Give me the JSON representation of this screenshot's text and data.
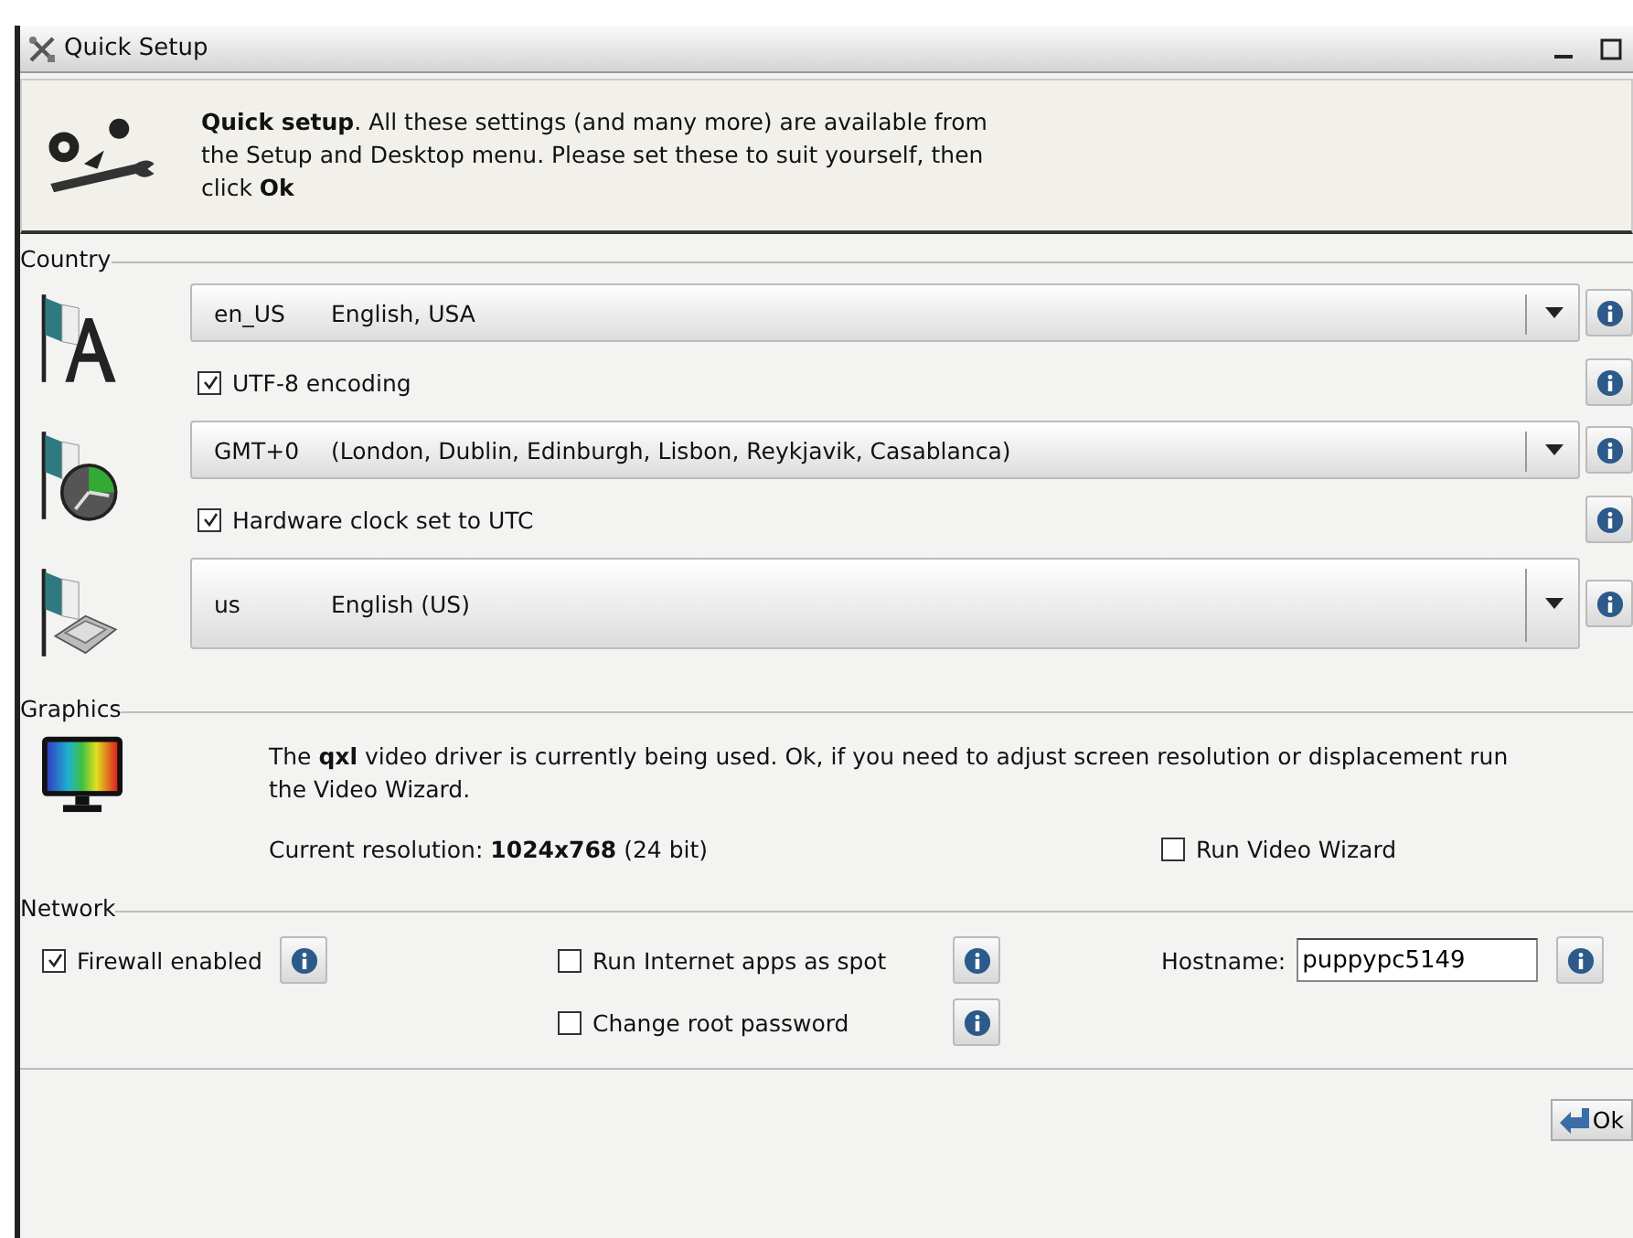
{
  "window": {
    "title": "Quick Setup"
  },
  "header": {
    "text": "**Quick setup**. All these settings (and many more) are available from the Setup and Desktop menu. Please set these to suit yourself, then click **Ok**"
  },
  "country": {
    "legend": "Country",
    "groups": [
      {
        "items": [
          {
            "kind": "combo",
            "code": "en_US",
            "label": "English, USA"
          },
          {
            "kind": "checkbox",
            "label": "UTF-8 encoding",
            "checked": true
          }
        ]
      },
      {
        "items": [
          {
            "kind": "combo",
            "code": "GMT+0",
            "label": "(London, Dublin, Edinburgh, Lisbon, Reykjavik, Casablanca)"
          },
          {
            "kind": "checkbox",
            "label": "Hardware clock set to UTC",
            "checked": true
          }
        ]
      },
      {
        "items": [
          {
            "kind": "combo",
            "code": "us",
            "label": "English (US)"
          }
        ]
      }
    ]
  },
  "graphics": {
    "legend": "Graphics",
    "description": "The **qxl** video driver is currently being used. Ok, if you need to adjust screen resolution or displacement run the Video Wizard.",
    "resolution": "Current resolution: **1024x768**  (24 bit)",
    "wizard": {
      "label": "Run Video Wizard",
      "checked": false
    }
  },
  "network": {
    "legend": "Network",
    "firewall": {
      "label": "Firewall enabled",
      "checked": true
    },
    "spot": {
      "label": "Run Internet apps as spot",
      "checked": false
    },
    "root_password": {
      "label": "Change root password",
      "checked": false
    },
    "hostname": {
      "label": "Hostname:",
      "value": "puppypc5149"
    }
  },
  "ok_button": {
    "label": "Ok"
  }
}
